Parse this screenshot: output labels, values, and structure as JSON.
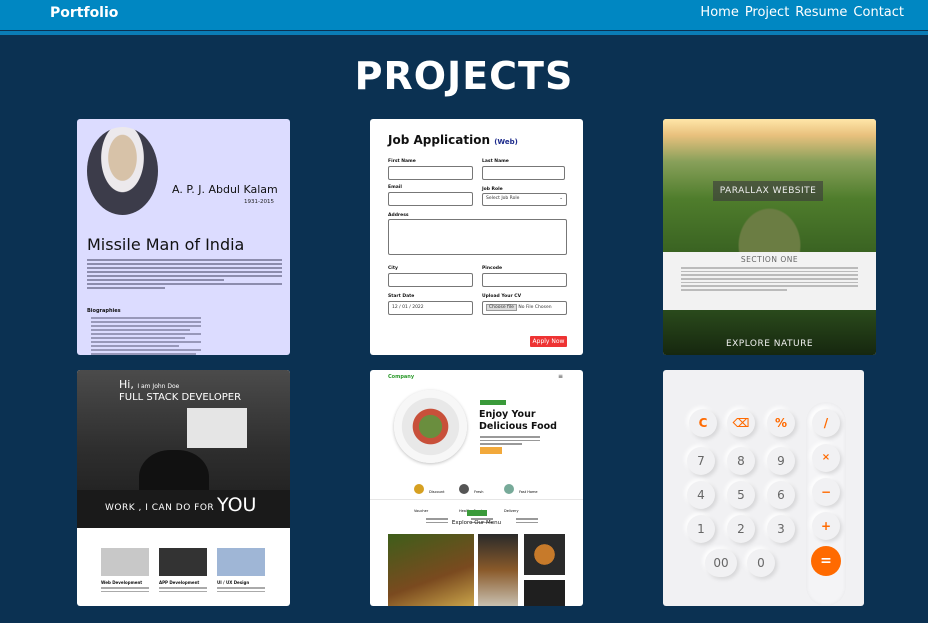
{
  "nav": {
    "brand": "Portfolio",
    "links": [
      "Home",
      "Project",
      "Resume",
      "Contact"
    ]
  },
  "page": {
    "title": "PROJECTS"
  },
  "projects": {
    "kalam": {
      "name": "A. P. J. Abdul Kalam",
      "years": "1931-2015",
      "headline": "Missile Man of India",
      "subheading": "Biographies"
    },
    "job": {
      "title": "Job Application",
      "tag": "(Web)",
      "labels": [
        "First Name",
        "Last Name",
        "Email",
        "Job Role",
        "Address",
        "City",
        "Pincode",
        "Start Date",
        "Upload Your CV"
      ],
      "job_role_value": "Select Job Role",
      "date_value": "12 / 01 / 2022",
      "file_button": "Choose file",
      "file_text": "No File Chosen",
      "apply": "Apply Now"
    },
    "parallax": {
      "title": "PARALLAX WEBSITE",
      "section": "SECTION ONE",
      "footer": "EXPLORE NATURE"
    },
    "fullstack": {
      "hi": "Hi,",
      "intro": "I am John Doe",
      "role": "FULL STACK DEVELOPER",
      "tagline": "WORK , I CAN DO FOR",
      "you": "YOU",
      "services": [
        "Web Development",
        "APP Development",
        "UI / UX Design"
      ]
    },
    "food": {
      "brand": "Company",
      "menu_icon": "hamburger-icon",
      "heading_line1": "Enjoy Your",
      "heading_line2": "Delicious Food",
      "features": [
        "Discount Voucher",
        "Fresh Healthy Food",
        "Fast Home Delivery"
      ],
      "explore": "Explore Our Menu"
    },
    "calculator": {
      "keys": [
        "C",
        "%",
        "/",
        "7",
        "8",
        "9",
        "4",
        "5",
        "6",
        "1",
        "2",
        "3",
        "00",
        "0",
        "=",
        "×",
        "−",
        "+"
      ],
      "backspace_icon": "backspace-icon",
      "accent": "#ff6a00"
    }
  },
  "colors": {
    "background": "#0b3152",
    "navbar": "#0087c2"
  }
}
